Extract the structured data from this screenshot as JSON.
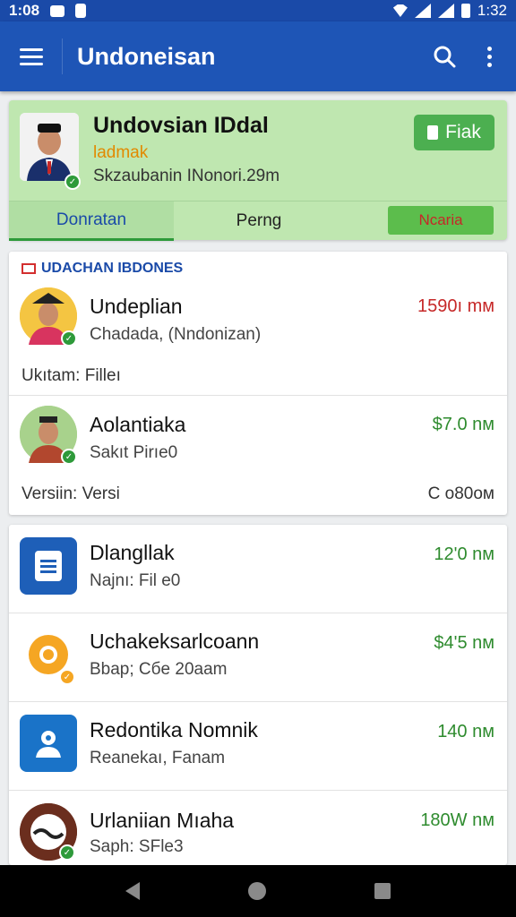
{
  "status_bar": {
    "time_left": "1:08",
    "time_right": "1:32"
  },
  "app_bar": {
    "title": "Undoneisan",
    "icons": [
      "menu-icon",
      "search-icon",
      "more-vert-icon"
    ]
  },
  "profile": {
    "name": "Undovsian IDdal",
    "subtitle": "ladmak",
    "meta": "Skzaubanin INonori.29m",
    "action_button": "Fiak",
    "tabs": [
      "Donratan",
      "Perng",
      "Ncaria"
    ]
  },
  "section": {
    "header": "UDACHAN IBDONES"
  },
  "featured_items": [
    {
      "title": "Undeplian",
      "subtitle": "Chadada, (Nndonizan)",
      "price": "1590ı mм",
      "footer_label": "Ukıtam: Filleı",
      "footer_right": ""
    },
    {
      "title": "Aolantiaka",
      "subtitle": "Sakıt Pirıe0",
      "price": "$7.0 nм",
      "footer_label": "Versiin: Versi",
      "footer_right": "C o80oм"
    }
  ],
  "apps": [
    {
      "title": "Dlangllak",
      "subtitle": "Najnı: Fil e0",
      "price": "12'0 nм",
      "icon": "document-icon"
    },
    {
      "title": "Uchakeksarlcoann",
      "subtitle": "Bbap; Cбe 20aam",
      "price": "$4'5 nм",
      "icon": "puzzle-icon"
    },
    {
      "title": "Redontika Nomnik",
      "subtitle": "Reanekaı, Fanam",
      "price": "140 nм",
      "icon": "people-icon"
    },
    {
      "title": "Urlaniian Mıaha",
      "subtitle": "Saph: SFle3",
      "price": "180W nм",
      "icon": "wave-icon"
    }
  ],
  "colors": {
    "app_bar": "#1e55b6",
    "profile_bg": "#bfe7b0",
    "price_red": "#c62828",
    "price_green": "#2e8b2e",
    "accent_green": "#4caf50"
  }
}
